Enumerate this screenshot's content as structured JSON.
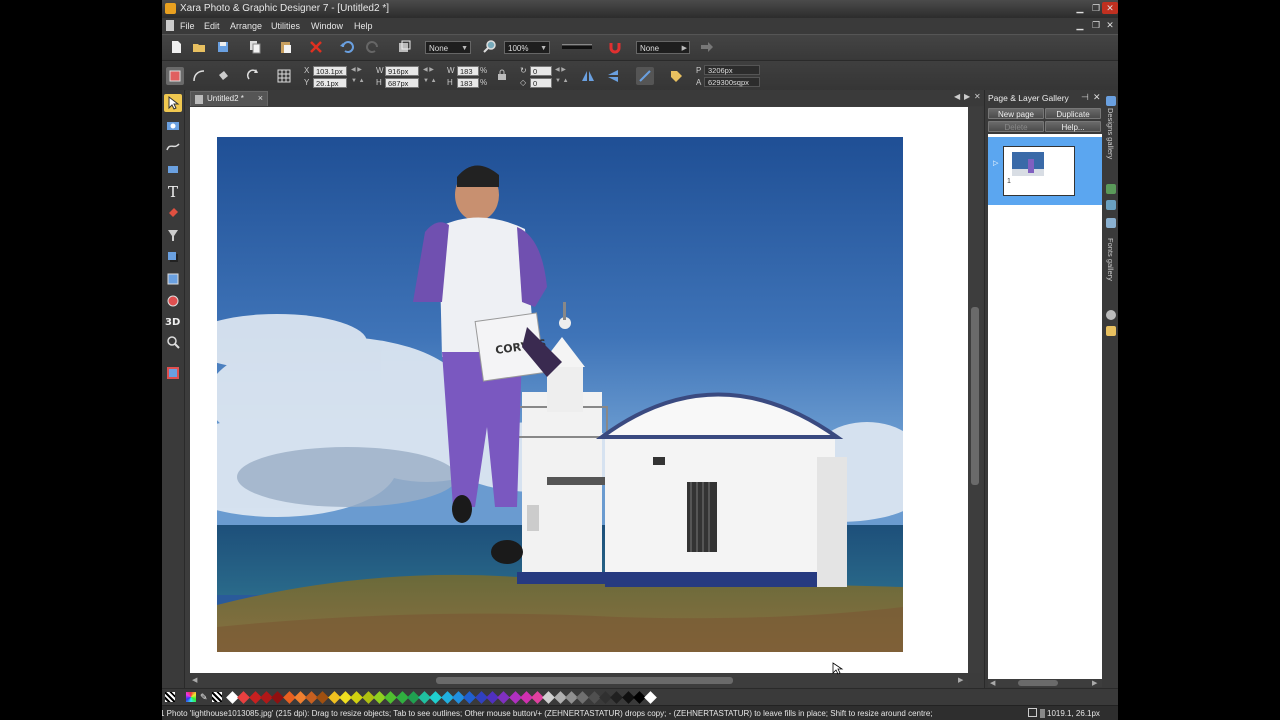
{
  "window": {
    "title": "Xara Photo & Graphic Designer 7 - [Untitled2 *]",
    "controls": [
      "minimize",
      "restore",
      "close"
    ]
  },
  "menu": [
    "File",
    "Edit",
    "Arrange",
    "Utilities",
    "Window",
    "Help"
  ],
  "toolbar": {
    "quality_value": "None",
    "zoom_value": "100%",
    "feather_value": "None"
  },
  "infobar": {
    "x_label": "X",
    "x_value": "103.1px",
    "y_label": "Y",
    "y_value": "26.1px",
    "w_label": "W",
    "w_value": "916px",
    "h_label": "H",
    "h_value": "687px",
    "ws_label": "W",
    "ws_value": "183",
    "hs_label": "H",
    "hs_value": "183",
    "pct": "%",
    "rot_value": "0",
    "skew_value": "0",
    "p_label": "P",
    "p_value": "3206px",
    "a_label": "A",
    "a_value": "629300sqpx"
  },
  "document": {
    "tab_title": "Untitled2 *",
    "close_glyph": "×"
  },
  "photo": {
    "bag_text": "CORVUS"
  },
  "gallery": {
    "title": "Page & Layer Gallery",
    "new_page": "New page",
    "duplicate": "Duplicate",
    "delete": "Delete",
    "help": "Help...",
    "page_number": "1"
  },
  "side_tabs": {
    "designs": "Designs gallery",
    "fonts": "Fonts gallery"
  },
  "status": {
    "message": "1 Photo 'lighthouse1013085.jpg' (215 dpi): Drag to resize objects; Tab to see outlines; Other mouse button/+ (ZEHNERTASTATUR) drops copy; - (ZEHNERTASTATUR) to leave fills in place; Shift to resize around centre;",
    "coords": "1019.1, 26.1px"
  },
  "palette": {
    "colors": [
      "#ffffff",
      "#e84040",
      "#c82020",
      "#b01818",
      "#901010",
      "#e86020",
      "#f08030",
      "#c86020",
      "#a05010",
      "#f0c020",
      "#f0e020",
      "#d0d010",
      "#b0c010",
      "#90d020",
      "#50c030",
      "#30b040",
      "#20a050",
      "#20c0a0",
      "#20d0d0",
      "#20b0e0",
      "#2090e0",
      "#2060d0",
      "#3040c0",
      "#5030c0",
      "#8030c0",
      "#b030c0",
      "#d030b0",
      "#e040a0",
      "#d0d0d0",
      "#b0b0b0",
      "#909090",
      "#707070",
      "#505050",
      "#303030",
      "#202020",
      "#101010",
      "#000000",
      "#ffffff"
    ]
  }
}
